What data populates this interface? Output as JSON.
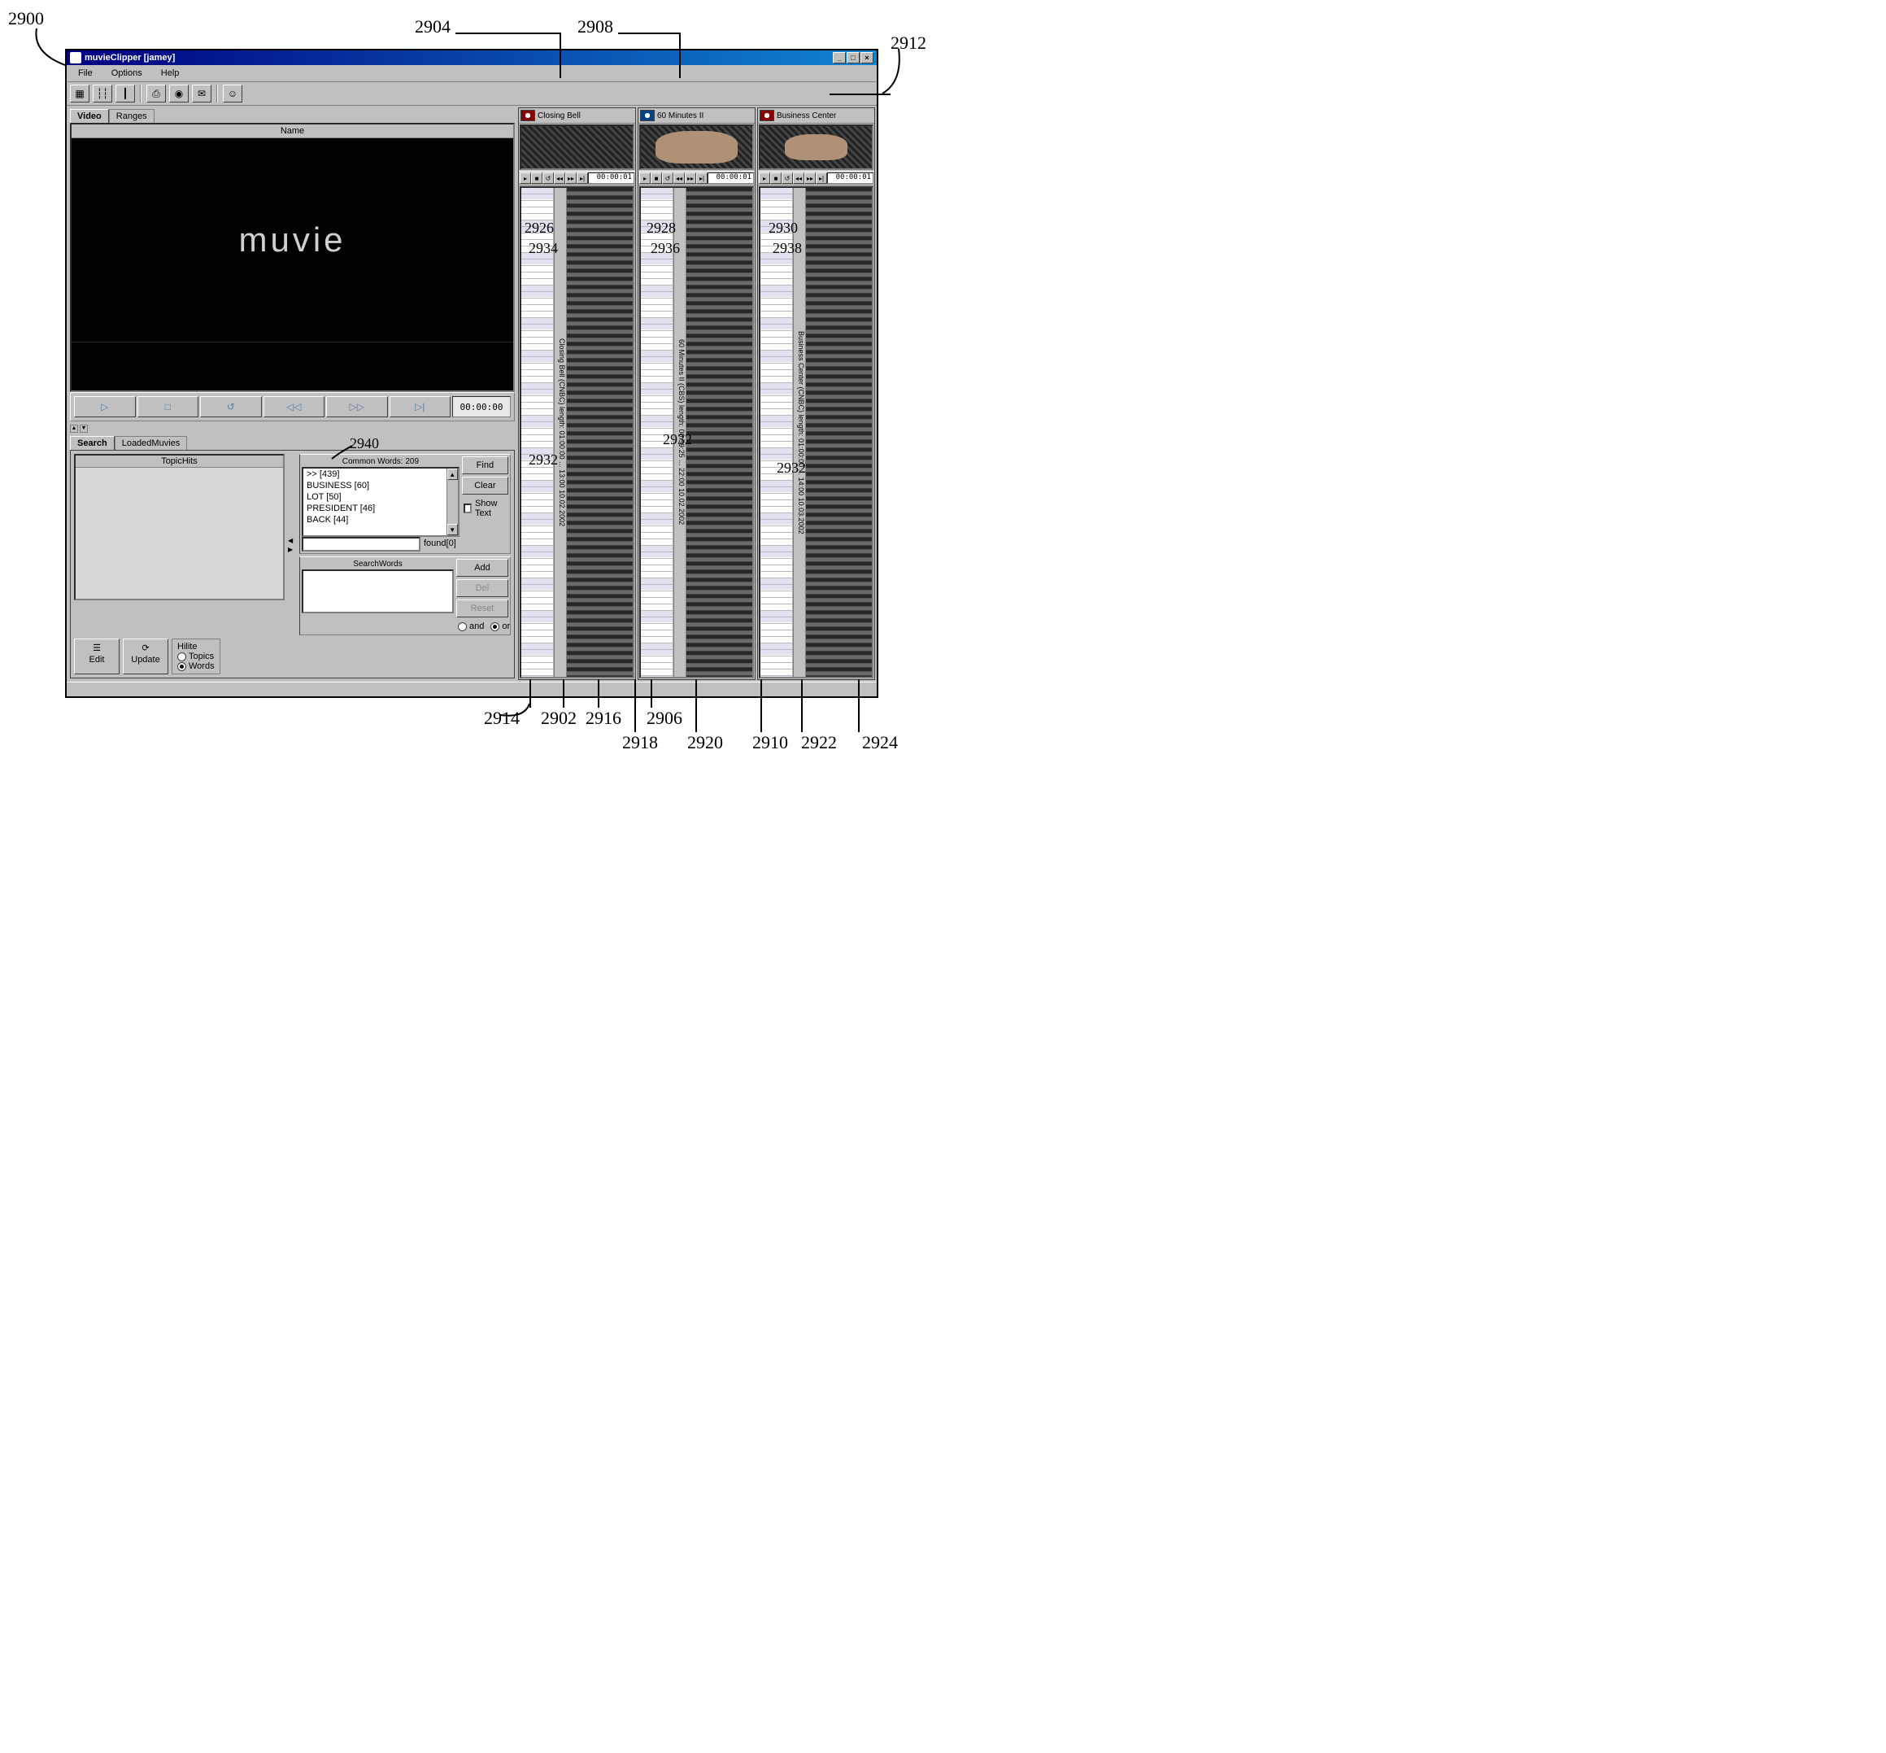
{
  "title": "muvieClipper [jamey]",
  "menu": {
    "file": "File",
    "options": "Options",
    "help": "Help"
  },
  "tabs_video": {
    "video": "Video",
    "ranges": "Ranges"
  },
  "name_header": "Name",
  "video_logo": "muvie",
  "main_tc": "00:00:00",
  "tabs_search": {
    "search": "Search",
    "loaded": "LoadedMuvies"
  },
  "topic_hits_header": "TopicHits",
  "common_words": {
    "header": "Common Words: 209",
    "items": [
      ">> [439]",
      "BUSINESS [60]",
      "LOT [50]",
      "PRESIDENT [46]",
      "BACK [44]"
    ],
    "found_label": "found[0]"
  },
  "buttons": {
    "find": "Find",
    "clear": "Clear",
    "show_text": "Show Text",
    "add": "Add",
    "del": "Del",
    "reset": "Reset",
    "edit": "Edit",
    "update": "Update"
  },
  "search_words_header": "SearchWords",
  "hilite": {
    "label": "Hilite",
    "topics": "Topics",
    "words": "Words"
  },
  "logic": {
    "and": "and",
    "or": "or"
  },
  "strips": [
    {
      "title": "Closing Bell",
      "tc": "00:00:01",
      "tl_label": "Closing Bell (CNBC)  length: 01:00:00 ... 13:00  10.02.2002"
    },
    {
      "title": "60 Minutes II",
      "tc": "00:00:01",
      "tl_label": "60 Minutes II (CBS)  length: 00:59:25 ... 22:00  10.02.2002"
    },
    {
      "title": "Business Center",
      "tc": "00:00:01",
      "tl_label": "Business Center (CNBC)  length: 01:00:00 ... 14:00  10.03.2002"
    }
  ],
  "annotations": {
    "n2900": "2900",
    "n2904": "2904",
    "n2908": "2908",
    "n2912": "2912",
    "n2926": "2926",
    "n2928": "2928",
    "n2930": "2930",
    "n2934": "2934",
    "n2936": "2936",
    "n2938": "2938",
    "n2932": "2932",
    "n2940": "2940",
    "n2914": "2914",
    "n2902": "2902",
    "n2916": "2916",
    "n2906": "2906",
    "n2918": "2918",
    "n2920": "2920",
    "n2910": "2910",
    "n2922": "2922",
    "n2924": "2924"
  }
}
